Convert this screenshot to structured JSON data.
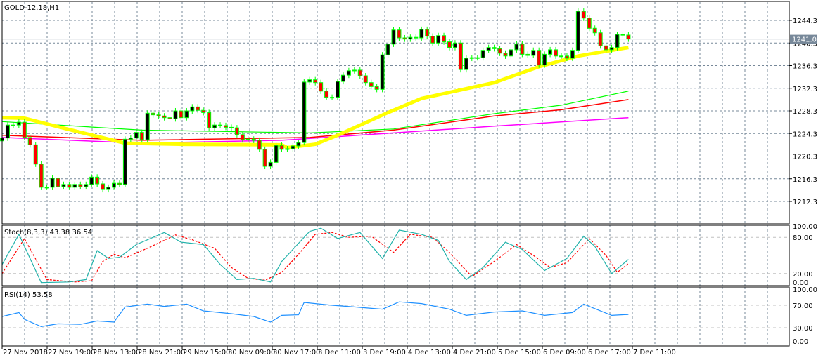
{
  "window": {
    "symbol_label": "GOLD-12.18,H1"
  },
  "colors": {
    "bull_fill": "#000000",
    "bear_fill": "#ff0000",
    "candle_outline": "#00ff00",
    "ma_yellow": "#ffff00",
    "ma_green": "#00ff00",
    "ma_red": "#ff0000",
    "ma_magenta": "#ff00ff",
    "stoch_main": "#20b2aa",
    "stoch_signal": "#ff0000",
    "rsi": "#1e90ff",
    "grid": "#778899",
    "price_tag": "#778899"
  },
  "current_price": {
    "value": 1241.0,
    "label": "1241.0"
  },
  "price_axis": {
    "labels": [
      "1244.3",
      "1240.3",
      "1236.3",
      "1232.3",
      "1228.3",
      "1224.3",
      "1220.3",
      "1216.3",
      "1212.3"
    ]
  },
  "time_axis": {
    "labels": [
      "27 Nov 2018",
      "27 Nov 19:00",
      "28 Nov 13:00",
      "28 Nov 21:00",
      "29 Nov 15:00",
      "30 Nov 09:00",
      "30 Nov 17:00",
      "3 Dec 11:00",
      "3 Dec 19:00",
      "4 Dec 13:00",
      "4 Dec 21:00",
      "5 Dec 15:00",
      "6 Dec 09:00",
      "6 Dec 17:00",
      "7 Dec 11:00"
    ]
  },
  "chart_data": [
    {
      "type": "candlestick",
      "title": "GOLD-12.18,H1",
      "first_open": 1223.0,
      "closes": [
        1223.5,
        1225.8,
        1225.8,
        1226.3,
        1223.6,
        1222.3,
        1218.9,
        1214.8,
        1214.8,
        1216.4,
        1214.9,
        1215.3,
        1214.8,
        1215.3,
        1214.9,
        1215.3,
        1216.6,
        1215.4,
        1214.4,
        1214.8,
        1215.5,
        1215.3,
        1223.3,
        1223.5,
        1224.5,
        1223.2,
        1227.9,
        1227.6,
        1227.4,
        1227.1,
        1226.9,
        1228.3,
        1227.1,
        1228.3,
        1229.0,
        1228.4,
        1228.0,
        1225.3,
        1225.8,
        1225.7,
        1225.4,
        1225.3,
        1224.1,
        1223.2,
        1223.3,
        1223.1,
        1221.5,
        1218.5,
        1219.2,
        1222.2,
        1221.5,
        1221.6,
        1222.1,
        1222.7,
        1233.4,
        1233.8,
        1233.3,
        1231.8,
        1230.7,
        1230.7,
        1233.5,
        1234.6,
        1235.4,
        1235.5,
        1234.5,
        1233.3,
        1232.6,
        1232.1,
        1238.2,
        1240.1,
        1242.6,
        1241.2,
        1241.0,
        1241.3,
        1241.2,
        1242.7,
        1241.5,
        1240.3,
        1241.6,
        1240.5,
        1239.5,
        1240.3,
        1235.6,
        1237.6,
        1237.7,
        1237.7,
        1239.0,
        1239.5,
        1239.3,
        1238.5,
        1238.0,
        1239.1,
        1240.1,
        1238.3,
        1238.1,
        1239.0,
        1236.4,
        1238.3,
        1239.1,
        1238.0,
        1238.0,
        1237.6,
        1239.0,
        1245.9,
        1244.7,
        1242.9,
        1242.1,
        1239.8,
        1239.1,
        1239.5,
        1241.8,
        1241.7,
        1241.0
      ],
      "moving_averages": [
        {
          "name": "ma-yellow",
          "points": [
            [
              0,
              1227.1
            ],
            [
              4,
              1227.0
            ],
            [
              12,
              1225.0
            ],
            [
              22,
              1222.6
            ],
            [
              32,
              1222.4
            ],
            [
              50,
              1222.3
            ],
            [
              51,
              1221.8
            ],
            [
              56,
              1222.4
            ],
            [
              60,
              1224.0
            ],
            [
              69,
              1228.0
            ],
            [
              75,
              1230.5
            ],
            [
              88,
              1233.3
            ],
            [
              96,
              1236.1
            ],
            [
              103,
              1238.0
            ],
            [
              109,
              1239.0
            ],
            [
              112,
              1239.5
            ]
          ]
        },
        {
          "name": "ma-green",
          "points": [
            [
              0,
              1226.4
            ],
            [
              25,
              1224.9
            ],
            [
              55,
              1224.4
            ],
            [
              70,
              1225.1
            ],
            [
              88,
              1227.8
            ],
            [
              100,
              1229.3
            ],
            [
              112,
              1231.8
            ]
          ]
        },
        {
          "name": "ma-red",
          "points": [
            [
              0,
              1224.0
            ],
            [
              25,
              1223.1
            ],
            [
              55,
              1223.6
            ],
            [
              70,
              1224.9
            ],
            [
              88,
              1227.4
            ],
            [
              100,
              1228.5
            ],
            [
              112,
              1230.3
            ]
          ]
        },
        {
          "name": "ma-magenta",
          "points": [
            [
              0,
              1223.6
            ],
            [
              25,
              1222.6
            ],
            [
              50,
              1223.1
            ],
            [
              70,
              1224.4
            ],
            [
              88,
              1225.6
            ],
            [
              112,
              1227.1
            ]
          ]
        }
      ],
      "ylim": [
        1209.3,
        1247.0
      ]
    },
    {
      "type": "line",
      "title": "Stoch(8,3,3) 43.38 36.54",
      "levels": [
        "100.00",
        "80.00",
        "20.00",
        "0.00"
      ],
      "series": [
        {
          "name": "main",
          "points": [
            [
              0,
              35
            ],
            [
              3,
              85
            ],
            [
              7,
              5
            ],
            [
              12,
              6
            ],
            [
              15,
              10
            ],
            [
              17,
              58
            ],
            [
              19,
              45
            ],
            [
              21,
              47
            ],
            [
              24,
              68
            ],
            [
              29,
              88
            ],
            [
              32,
              72
            ],
            [
              36,
              68
            ],
            [
              39,
              35
            ],
            [
              42,
              10
            ],
            [
              45,
              12
            ],
            [
              48,
              6
            ],
            [
              50,
              40
            ],
            [
              52,
              60
            ],
            [
              55,
              90
            ],
            [
              57,
              95
            ],
            [
              60,
              78
            ],
            [
              64,
              88
            ],
            [
              68,
              45
            ],
            [
              71,
              92
            ],
            [
              75,
              85
            ],
            [
              78,
              75
            ],
            [
              80,
              40
            ],
            [
              83,
              10
            ],
            [
              86,
              30
            ],
            [
              90,
              72
            ],
            [
              93,
              60
            ],
            [
              97,
              25
            ],
            [
              99,
              35
            ],
            [
              101,
              45
            ],
            [
              104,
              82
            ],
            [
              106,
              65
            ],
            [
              109,
              20
            ],
            [
              112,
              43.38
            ]
          ]
        },
        {
          "name": "signal",
          "points": [
            [
              0,
              20
            ],
            [
              4,
              78
            ],
            [
              8,
              10
            ],
            [
              13,
              6
            ],
            [
              16,
              8
            ],
            [
              18,
              40
            ],
            [
              20,
              52
            ],
            [
              22,
              46
            ],
            [
              26,
              62
            ],
            [
              31,
              84
            ],
            [
              34,
              76
            ],
            [
              38,
              62
            ],
            [
              41,
              30
            ],
            [
              44,
              12
            ],
            [
              47,
              9
            ],
            [
              50,
              22
            ],
            [
              53,
              52
            ],
            [
              56,
              85
            ],
            [
              59,
              88
            ],
            [
              62,
              80
            ],
            [
              66,
              82
            ],
            [
              70,
              55
            ],
            [
              73,
              85
            ],
            [
              77,
              80
            ],
            [
              80,
              55
            ],
            [
              84,
              15
            ],
            [
              88,
              40
            ],
            [
              92,
              68
            ],
            [
              95,
              50
            ],
            [
              98,
              30
            ],
            [
              101,
              38
            ],
            [
              105,
              78
            ],
            [
              108,
              50
            ],
            [
              110,
              22
            ],
            [
              112,
              36.54
            ]
          ]
        }
      ],
      "ylim": [
        0,
        100
      ]
    },
    {
      "type": "line",
      "title": "RSI(14) 53.58",
      "levels": [
        "100.00",
        "70.00",
        "30.00",
        "0.00"
      ],
      "series": [
        {
          "name": "rsi",
          "points": [
            [
              0,
              50
            ],
            [
              3,
              57
            ],
            [
              4,
              45
            ],
            [
              7,
              32
            ],
            [
              10,
              37
            ],
            [
              14,
              36
            ],
            [
              17,
              42
            ],
            [
              20,
              40
            ],
            [
              22,
              67
            ],
            [
              26,
              72
            ],
            [
              29,
              68
            ],
            [
              33,
              72
            ],
            [
              36,
              60
            ],
            [
              41,
              55
            ],
            [
              45,
              50
            ],
            [
              48,
              40
            ],
            [
              50,
              52
            ],
            [
              53,
              53
            ],
            [
              54,
              75
            ],
            [
              59,
              70
            ],
            [
              63,
              67
            ],
            [
              68,
              63
            ],
            [
              71,
              76
            ],
            [
              75,
              73
            ],
            [
              80,
              63
            ],
            [
              83,
              52
            ],
            [
              88,
              58
            ],
            [
              93,
              60
            ],
            [
              97,
              52
            ],
            [
              102,
              57
            ],
            [
              104,
              72
            ],
            [
              109,
              52
            ],
            [
              112,
              53.58
            ]
          ]
        }
      ],
      "ylim": [
        0,
        100
      ]
    }
  ]
}
